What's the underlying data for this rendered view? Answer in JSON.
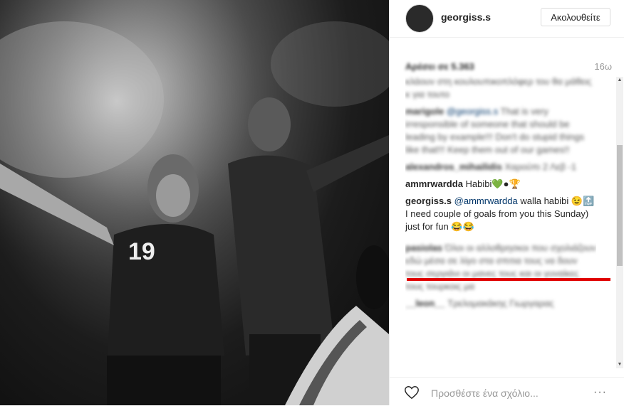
{
  "post": {
    "username": "georgiss.s",
    "follow_label": "Ακολουθείτε",
    "likes": "Αρέσει σε 5.363",
    "time": "16ω",
    "add_comment_placeholder": "Προσθέστε ένα σχόλιο...",
    "more_label": "···"
  },
  "comments": [
    {
      "user": "",
      "text": "κλάουν στη κουλουπικοπλόφερ του θα μάθεις κ για τουτο",
      "blurred": true
    },
    {
      "user": "marigole",
      "mention": "@georgiss.s",
      "text": "That is very irresponsible of someone that should be leading by example!!! Don't do stupid things like that!!! Keep them out of our games!!",
      "blurred": true
    },
    {
      "user": "alexandros_mihailidis",
      "text": "Χαρούπι 2 Λεβ -1",
      "blurred": true
    },
    {
      "user": "ammrwardda",
      "text": "Habibi💚●🏆",
      "blurred": false
    },
    {
      "user": "georgiss.s",
      "mention": "@ammrwardda",
      "text": "walla habibi 😉🔝 I need couple of goals from you this Sunday) just for fun 😂😂",
      "blurred": false
    },
    {
      "user": "pasiolas",
      "text": "Όλοι οι αλλοθρησκοι που σχολιάζουν εδώ μέσα σε λίγο στα σπιτια τους να δουν τους σεργιάνι οι μανες τους και οι γυναίκες τους τουρκοις μα",
      "blurred": true
    },
    {
      "user": "__leon__",
      "text": "Τρελομακάκης Γιωργαρας",
      "blurred": true
    }
  ]
}
